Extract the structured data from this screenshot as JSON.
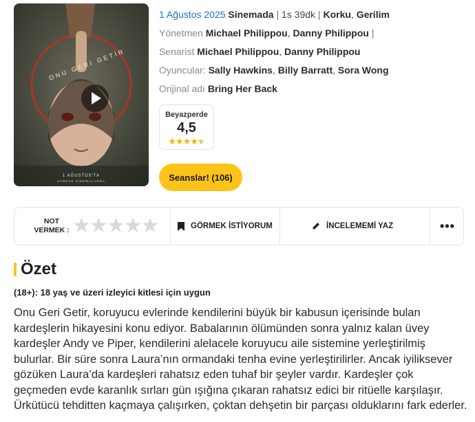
{
  "movie": {
    "release_date": "1 Ağustos 2025",
    "status": "Sinemada",
    "duration": "1s 39dk",
    "genres": [
      "Korku",
      "Gerilim"
    ],
    "director_label": "Yönetmen",
    "directors": [
      "Michael Philippou",
      "Danny Philippou"
    ],
    "writer_label": "Senarist",
    "writers": [
      "Michael Philippou",
      "Danny Philippou"
    ],
    "cast_label": "Oyuncular:",
    "cast": [
      "Sally Hawkins",
      "Billy Barratt",
      "Sora Wong"
    ],
    "original_title_label": "Orijinal adı",
    "original_title": "Bring Her Back"
  },
  "poster": {
    "title_text": "ONU GERİ GETİR",
    "caption_line1": "1 AĞUSTOS'TA",
    "caption_line2": "SADECE SİNEMALARDA",
    "icon": "play-icon"
  },
  "rating": {
    "source": "Beyazperde",
    "score": "4,5",
    "stars_filled": 4.5,
    "stars_max": 5,
    "star_color": "#f5b400"
  },
  "showtimes": {
    "label": "Seanslar! (106)",
    "color": "#fcc419"
  },
  "actions": {
    "rate_label_line1": "NOT",
    "rate_label_line2": "VERMEK :",
    "watchlist_label": "GÖRMEK İSTİYORUM",
    "watchlist_icon": "bookmark-icon",
    "review_label": "İNCELEMEMİ YAZ",
    "review_icon": "pencil-icon",
    "more_label": "•••"
  },
  "summary": {
    "title": "Özet",
    "age_rating": "(18+): 18 yaş ve üzeri izleyici kitlesi için uygun",
    "text": "Onu Geri Getir, koruyucu evlerinde kendilerini büyük bir kabusun içerisinde bulan kardeşlerin hikayesini konu ediyor. Babalarının ölümünden sonra yalnız kalan üvey kardeşler Andy ve Piper, kendilerini alelacele koruyucu aile sistemine yerleştirilmiş bulurlar. Bir süre sonra Laura’nın ormandaki tenha evine yerleştirilirler. Ancak iyiliksever gözüken Laura’da kardeşleri rahatsız eden tuhaf bir şeyler vardır. Kardeşler çok geçmeden evde karanlık sırları gün ışığına çıkaran rahatsız edici bir ritüelle karşılaşır. Ürkütücü tehditten kaçmaya çalışırken, çoktan dehşetin bir parçası olduklarını fark ederler."
  },
  "colors": {
    "accent": "#fcc419",
    "link": "#1f6fd1"
  }
}
